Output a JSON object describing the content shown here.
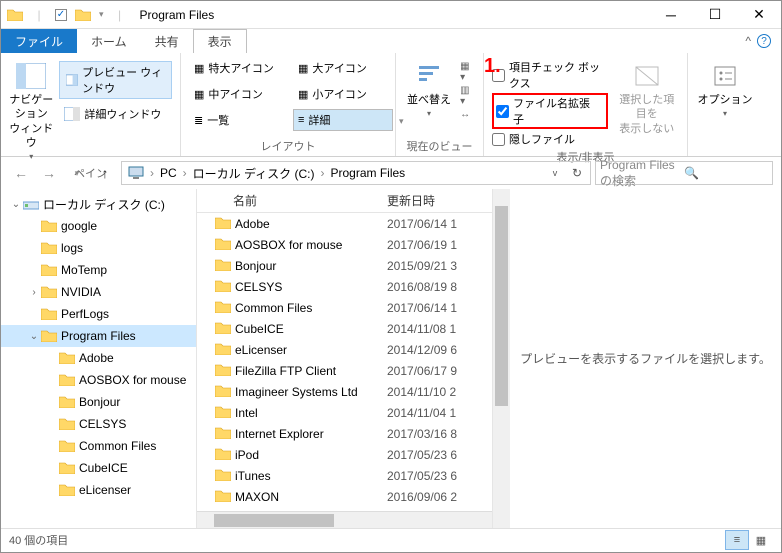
{
  "title": "Program Files",
  "annotation": "1.",
  "tabs": {
    "file": "ファイル",
    "home": "ホーム",
    "share": "共有",
    "view": "表示"
  },
  "ribbon": {
    "pane": {
      "nav": "ナビゲーション\nウィンドウ",
      "preview": "プレビュー ウィンドウ",
      "details": "詳細ウィンドウ",
      "label": "ペイン"
    },
    "layout": {
      "xlarge": "特大アイコン",
      "large": "大アイコン",
      "medium": "中アイコン",
      "small": "小アイコン",
      "list": "一覧",
      "detailsv": "詳細",
      "label": "レイアウト"
    },
    "currentview": {
      "sort": "並べ替え",
      "label": "現在のビュー"
    },
    "showhide": {
      "itemcheck": "項目チェック ボックス",
      "fileext": "ファイル名拡張子",
      "hidden": "隠しファイル",
      "hidesel": "選択した項目を\n表示しない",
      "label": "表示/非表示"
    },
    "options": {
      "options": "オプション",
      "label": ""
    }
  },
  "breadcrumb": {
    "pc": "PC",
    "drive": "ローカル ディスク (C:)",
    "folder": "Program Files"
  },
  "search_placeholder": "Program Filesの検索",
  "tree": [
    {
      "depth": 0,
      "exp": "v",
      "icon": "drive",
      "label": "ローカル ディスク (C:)"
    },
    {
      "depth": 1,
      "exp": "",
      "icon": "folder",
      "label": "google"
    },
    {
      "depth": 1,
      "exp": "",
      "icon": "folder",
      "label": "logs"
    },
    {
      "depth": 1,
      "exp": "",
      "icon": "folder",
      "label": "MoTemp"
    },
    {
      "depth": 1,
      "exp": ">",
      "icon": "folder",
      "label": "NVIDIA"
    },
    {
      "depth": 1,
      "exp": "",
      "icon": "folder",
      "label": "PerfLogs"
    },
    {
      "depth": 1,
      "exp": "v",
      "icon": "folder",
      "label": "Program Files",
      "selected": true
    },
    {
      "depth": 2,
      "exp": "",
      "icon": "folder",
      "label": "Adobe"
    },
    {
      "depth": 2,
      "exp": "",
      "icon": "folder",
      "label": "AOSBOX for mouse"
    },
    {
      "depth": 2,
      "exp": "",
      "icon": "folder",
      "label": "Bonjour"
    },
    {
      "depth": 2,
      "exp": "",
      "icon": "folder",
      "label": "CELSYS"
    },
    {
      "depth": 2,
      "exp": "",
      "icon": "folder",
      "label": "Common Files"
    },
    {
      "depth": 2,
      "exp": "",
      "icon": "folder",
      "label": "CubeICE"
    },
    {
      "depth": 2,
      "exp": "",
      "icon": "folder",
      "label": "eLicenser"
    }
  ],
  "columns": {
    "name": "名前",
    "date": "更新日時"
  },
  "files": [
    {
      "name": "Adobe",
      "date": "2017/06/14 1"
    },
    {
      "name": "AOSBOX for mouse",
      "date": "2017/06/19 1"
    },
    {
      "name": "Bonjour",
      "date": "2015/09/21 3"
    },
    {
      "name": "CELSYS",
      "date": "2016/08/19 8"
    },
    {
      "name": "Common Files",
      "date": "2017/06/14 1"
    },
    {
      "name": "CubeICE",
      "date": "2014/11/08 1"
    },
    {
      "name": "eLicenser",
      "date": "2014/12/09 6"
    },
    {
      "name": "FileZilla FTP Client",
      "date": "2017/06/17 9"
    },
    {
      "name": "Imagineer Systems Ltd",
      "date": "2014/11/10 2"
    },
    {
      "name": "Intel",
      "date": "2014/11/04 1"
    },
    {
      "name": "Internet Explorer",
      "date": "2017/03/16 8"
    },
    {
      "name": "iPod",
      "date": "2017/05/23 6"
    },
    {
      "name": "iTunes",
      "date": "2017/05/23 6"
    },
    {
      "name": "MAXON",
      "date": "2016/09/06 2"
    }
  ],
  "preview_empty": "プレビューを表示するファイルを選択します。",
  "status": "40 個の項目"
}
